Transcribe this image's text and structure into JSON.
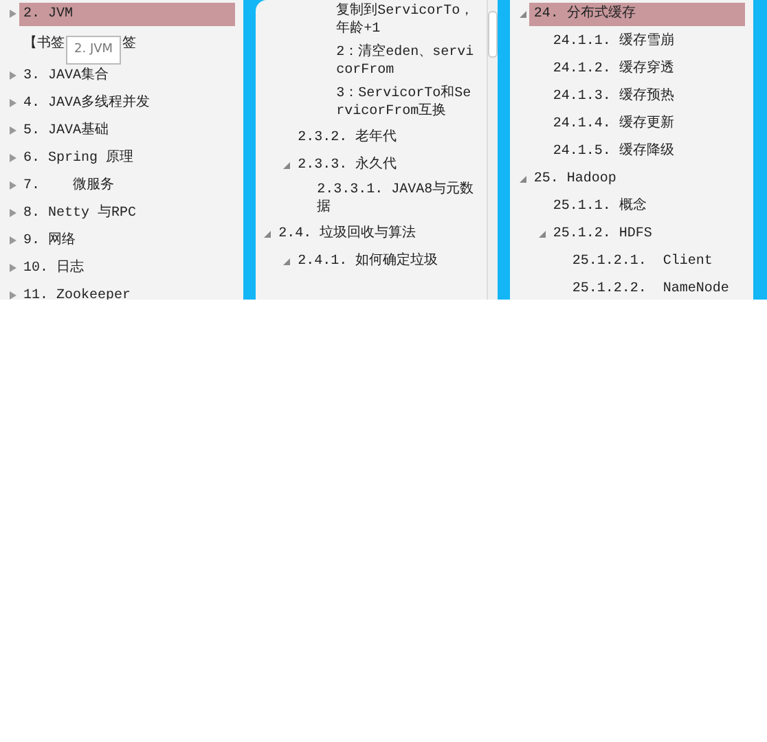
{
  "panels": [
    {
      "items": [
        {
          "label": "2. JVM",
          "expanded": false,
          "selected": true
        },
        {
          "label": "【书签",
          "tooltip": "2. JVM",
          "tail": "签",
          "selected": false
        },
        {
          "label": "3. JAVA集合",
          "expanded": false,
          "selected": false
        },
        {
          "label": "4. JAVA多线程并发",
          "expanded": false,
          "selected": false
        },
        {
          "label": "5. JAVA基础",
          "expanded": false,
          "selected": false
        },
        {
          "label": "6. Spring 原理",
          "expanded": false,
          "selected": false
        },
        {
          "label": "7.    微服务",
          "expanded": false,
          "selected": false
        },
        {
          "label": "8. Netty 与RPC",
          "expanded": false,
          "selected": false
        },
        {
          "label": "9. 网络",
          "expanded": false,
          "selected": false
        },
        {
          "label": "10. 日志",
          "expanded": false,
          "selected": false
        },
        {
          "label": "11. Zookeeper",
          "expanded": false,
          "selected": false
        }
      ]
    },
    {
      "scrollbar": true,
      "items": [
        {
          "children": [
            {
              "children": [
                {
                  "children": [
                    {
                      "label": "复制到ServicorTo，年龄+1",
                      "selected": false
                    },
                    {
                      "label": "2：清空eden、servicorFrom",
                      "selected": false
                    },
                    {
                      "label": "3：ServicorTo和ServicorFrom互换",
                      "selected": false
                    }
                  ]
                }
              ]
            },
            {
              "label": "2.3.2. 老年代",
              "selected": false
            },
            {
              "label": "2.3.3. 永久代",
              "expanded": true,
              "selected": false,
              "children": [
                {
                  "label": "2.3.3.1. JAVA8与元数据",
                  "selected": false
                }
              ]
            }
          ]
        },
        {
          "label": "2.4. 垃圾回收与算法",
          "expanded": true,
          "selected": false,
          "children": [
            {
              "label": "2.4.1. 如何确定垃圾",
              "expanded": true,
              "selected": false
            }
          ]
        }
      ]
    },
    {
      "items": [
        {
          "label": "24. 分布式缓存",
          "expanded": true,
          "selected": true,
          "children": [
            {
              "label": "24.1.1. 缓存雪崩",
              "selected": false
            },
            {
              "label": "24.1.2. 缓存穿透",
              "selected": false
            },
            {
              "label": "24.1.3. 缓存预热",
              "selected": false
            },
            {
              "label": "24.1.4. 缓存更新",
              "selected": false
            },
            {
              "label": "24.1.5. 缓存降级",
              "selected": false
            }
          ]
        },
        {
          "label": "25. Hadoop",
          "expanded": true,
          "selected": false,
          "children": [
            {
              "label": "25.1.1. 概念",
              "selected": false
            },
            {
              "label": "25.1.2. HDFS",
              "expanded": true,
              "selected": false,
              "children": [
                {
                  "label": "25.1.2.1.  Client",
                  "selected": false
                },
                {
                  "label": "25.1.2.2.  NameNode",
                  "selected": false
                }
              ]
            }
          ]
        }
      ]
    }
  ]
}
